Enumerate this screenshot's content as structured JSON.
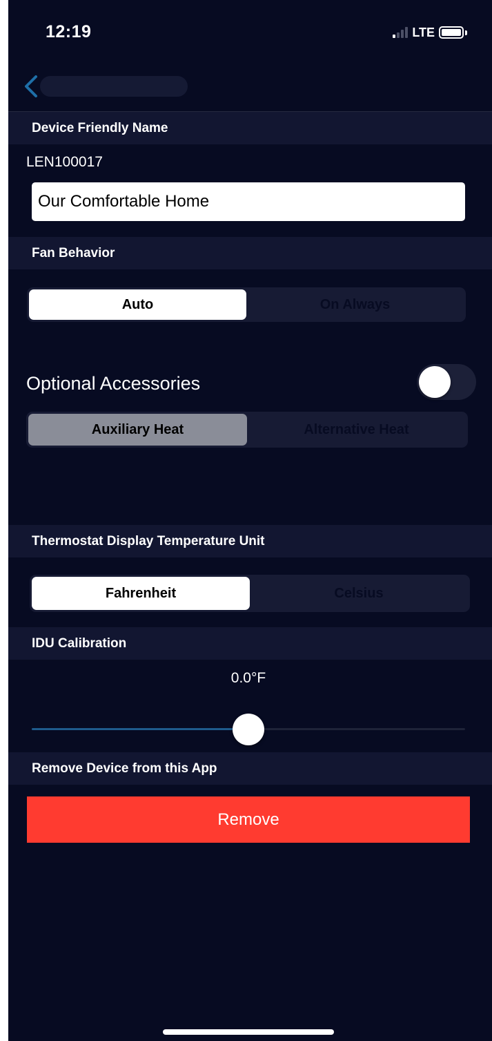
{
  "status_bar": {
    "time": "12:19",
    "network": "LTE",
    "signal_icon": "cellular-signal-icon",
    "battery_icon": "battery-icon"
  },
  "nav": {
    "back_icon": "chevron-left-icon",
    "back_color": "#1e6fa8"
  },
  "device_name": {
    "header": "Device Friendly Name",
    "device_id": "LEN100017",
    "input_value": "Our Comfortable Home"
  },
  "fan_behavior": {
    "header": "Fan Behavior",
    "options": [
      "Auto",
      "On Always"
    ],
    "selected": "Auto"
  },
  "optional_accessories": {
    "title": "Optional Accessories",
    "toggle_on": false,
    "options": [
      "Auxiliary Heat",
      "Alternative Heat"
    ],
    "selected": "Auxiliary Heat"
  },
  "temperature_unit": {
    "header": "Thermostat Display Temperature Unit",
    "options": [
      "Fahrenheit",
      "Celsius"
    ],
    "selected": "Fahrenheit"
  },
  "idu_calibration": {
    "header": "IDU Calibration",
    "value_text": "0.0°F",
    "slider_fraction": 0.5
  },
  "remove_device": {
    "header": "Remove Device from this App",
    "button_label": "Remove",
    "button_color": "#ff3b30"
  }
}
